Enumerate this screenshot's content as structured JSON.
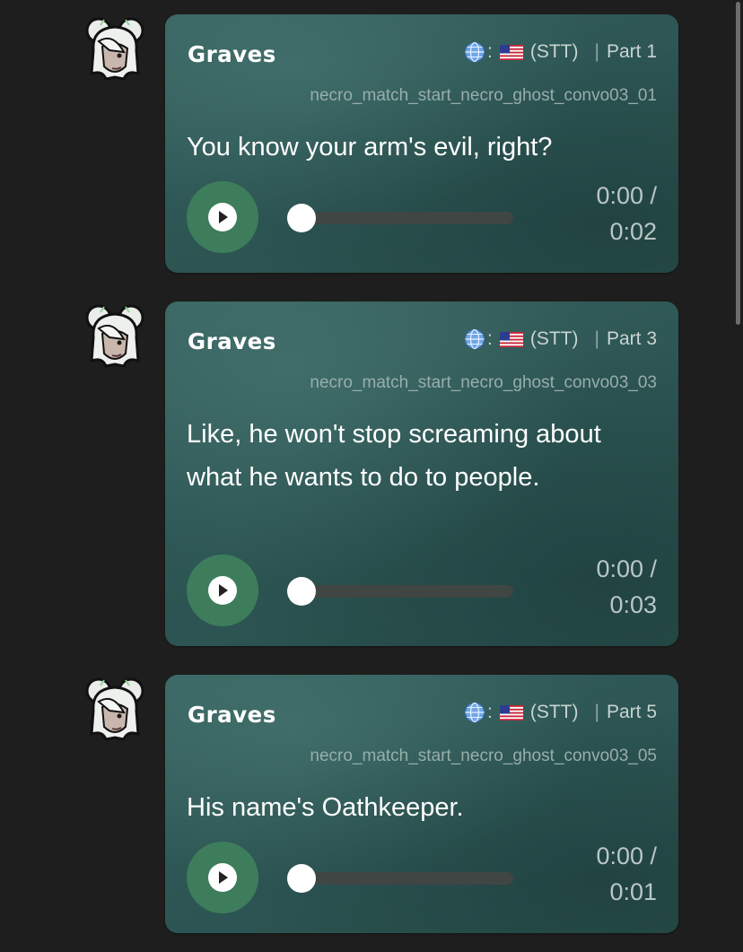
{
  "messages": [
    {
      "speaker": "Graves",
      "lang_separator": ":",
      "mode": "(STT)",
      "separator": "|",
      "part": "Part 1",
      "voice_id": "necro_match_start_necro_ghost_convo03_01",
      "text": "You know your arm's evil, right?",
      "current_time": "0:00 /",
      "duration": "0:02",
      "progress": 0
    },
    {
      "speaker": "Graves",
      "lang_separator": ":",
      "mode": "(STT)",
      "separator": "|",
      "part": "Part 3",
      "voice_id": "necro_match_start_necro_ghost_convo03_03",
      "text": "Like, he won't stop screaming about what he wants to do to people.",
      "current_time": "0:00 /",
      "duration": "0:03",
      "progress": 0
    },
    {
      "speaker": "Graves",
      "lang_separator": ":",
      "mode": "(STT)",
      "separator": "|",
      "part": "Part 5",
      "voice_id": "necro_match_start_necro_ghost_convo03_05",
      "text": "His name's Oathkeeper.",
      "current_time": "0:00 /",
      "duration": "0:01",
      "progress": 0
    }
  ],
  "icons": {
    "language": "globe-icon",
    "flag": "us-flag-icon",
    "play": "play-icon",
    "avatar": "character-avatar"
  },
  "colors": {
    "background": "#1e1e1e",
    "bubble": "#2f5856",
    "play_button": "#3d7d5c",
    "seek_track": "#3f4644",
    "text": "#ffffff"
  }
}
